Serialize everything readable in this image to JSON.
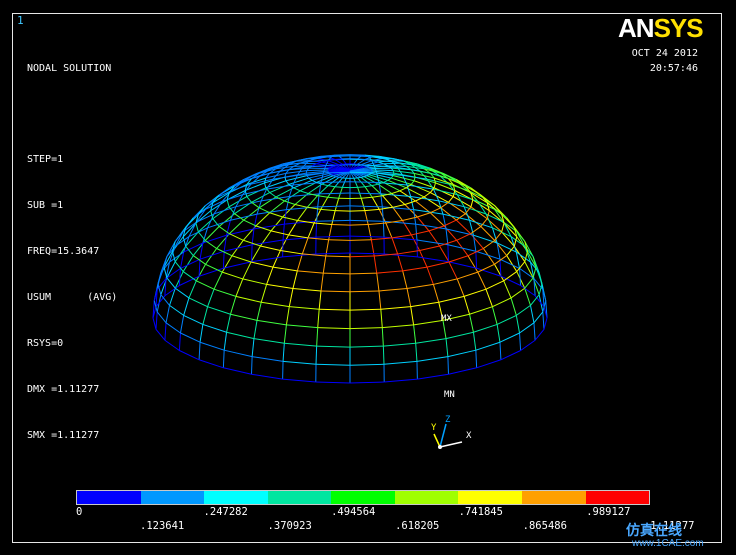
{
  "window": {
    "number": "1"
  },
  "info": {
    "lines": [
      "NODAL SOLUTION",
      "",
      "STEP=1",
      "SUB =1",
      "FREQ=15.3647",
      "USUM      (AVG)",
      "RSYS=0",
      "DMX =1.11277",
      "SMX =1.11277"
    ]
  },
  "logo": {
    "text_a": "AN",
    "text_b": "SYS"
  },
  "date": {
    "date": "OCT 24 2012",
    "time": "20:57:46"
  },
  "markers": {
    "max": "MX",
    "min": "MN"
  },
  "triad": {
    "y": "Y",
    "z": "Z",
    "x": "X"
  },
  "legend": {
    "colors": [
      "#0000ff",
      "#0098ff",
      "#00ffff",
      "#00e6a0",
      "#00ff00",
      "#a0ff00",
      "#ffff00",
      "#ffa000",
      "#ff0000"
    ],
    "top_labels": [
      "0",
      ".247282",
      ".494564",
      ".741845",
      ".989127"
    ],
    "bottom_labels": [
      ".123641",
      ".370923",
      ".618205",
      ".865486",
      "1.11277"
    ]
  },
  "watermark": {
    "line1": "仿真在线",
    "line2": "www.1CAE.com"
  }
}
